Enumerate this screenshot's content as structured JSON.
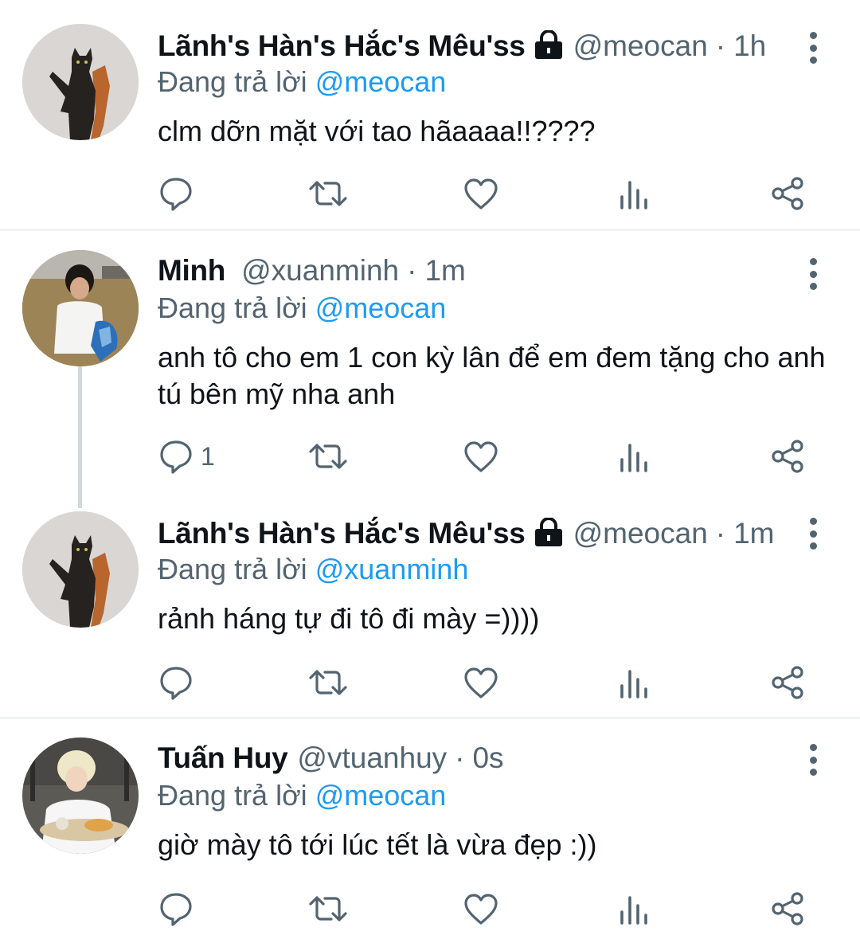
{
  "tweets": [
    {
      "name": "Lãnh's Hàn's Hắc's Mêu'ss",
      "protected": true,
      "handle": "@meocan",
      "dot": "·",
      "time": "1h",
      "replying_prefix": "Đang trả lời",
      "replying_to": "@meocan",
      "text": "clm dỡn mặt với tao hãaaaa!!????",
      "reply_count": "",
      "avatar": "black-cat"
    },
    {
      "name": "Minh",
      "protected": false,
      "handle": "@xuanminh",
      "dot": "·",
      "time": "1m",
      "replying_prefix": "Đang trả lời",
      "replying_to": "@meocan",
      "text": "anh tô cho em 1 con kỳ lân để em đem tặng cho anh tú bên mỹ nha anh",
      "reply_count": "1",
      "avatar": "boy-in-field"
    },
    {
      "name": "Lãnh's Hàn's Hắc's Mêu'ss",
      "protected": true,
      "handle": "@meocan",
      "dot": "·",
      "time": "1m",
      "replying_prefix": "Đang trả lời",
      "replying_to": "@xuanminh",
      "text": "rảnh háng tự đi tô đi mày =))))",
      "reply_count": "",
      "avatar": "black-cat"
    },
    {
      "name": "Tuấn Huy",
      "protected": false,
      "handle": "@vtuanhuy",
      "dot": "·",
      "time": "0s",
      "replying_prefix": "Đang trả lời",
      "replying_to": "@meocan",
      "text": "giờ mày tô tới lúc tết là vừa đẹp :))",
      "reply_count": "",
      "avatar": "blond-person-eating"
    }
  ],
  "icons": {
    "reply": "reply-icon",
    "retweet": "retweet-icon",
    "like": "like-icon",
    "views": "views-icon",
    "share": "share-icon",
    "more": "more-icon",
    "lock": "lock-icon"
  },
  "colors": {
    "text": "#0f1419",
    "muted": "#536471",
    "link": "#1d9bf0",
    "divider": "#eff3f4",
    "thread_line": "#cfd9de"
  }
}
